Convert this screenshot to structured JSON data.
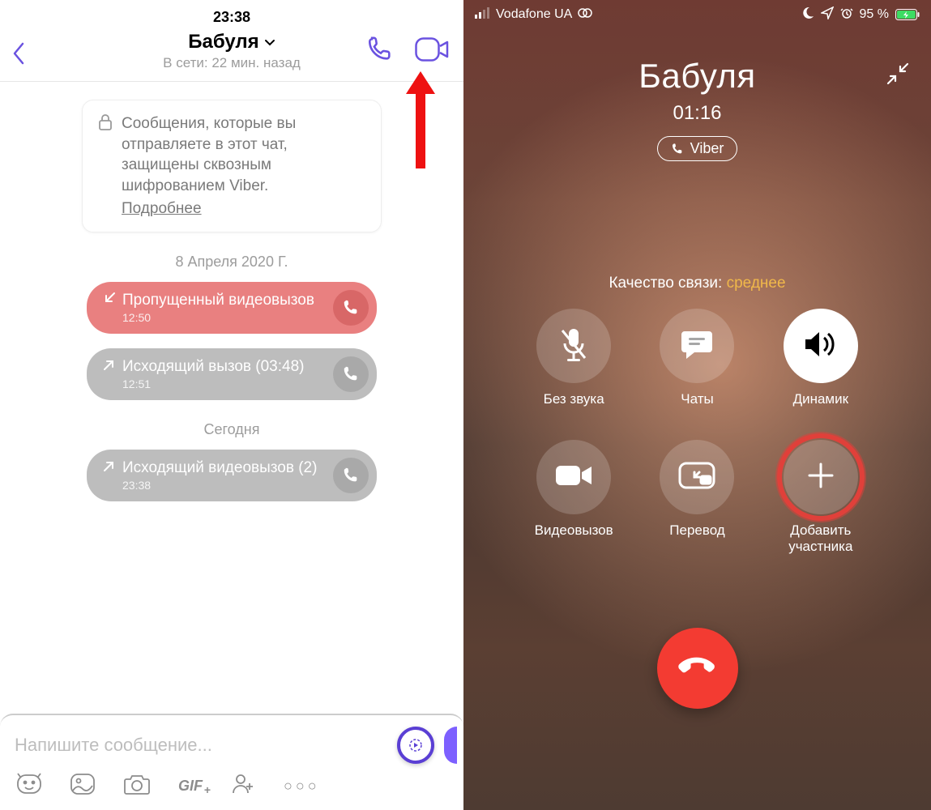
{
  "left": {
    "status_time": "23:38",
    "contact_name": "Бабуля",
    "last_seen": "В сети: 22 мин. назад",
    "encryption_text": "Сообщения, которые вы отправляете в этот чат, защищены сквозным шифрованием Viber.",
    "encryption_more": "Подробнее",
    "date1": "8 Апреля 2020 Г.",
    "items": [
      {
        "title": "Пропущенный видеовызов",
        "time": "12:50",
        "direction": "in",
        "color": "red"
      },
      {
        "title": "Исходящий вызов (03:48)",
        "time": "12:51",
        "direction": "out",
        "color": "gray"
      }
    ],
    "date2": "Сегодня",
    "items2": [
      {
        "title": "Исходящий видеовызов (2)",
        "time": "23:38",
        "direction": "out",
        "color": "gray"
      }
    ],
    "input_placeholder": "Напишите сообщение..."
  },
  "right": {
    "carrier": "Vodafone UA",
    "battery": "95 %",
    "contact_name": "Бабуля",
    "duration": "01:16",
    "app_badge": "Viber",
    "quality_label": "Качество связи: ",
    "quality_value": "среднее",
    "btns": {
      "mute": "Без звука",
      "chats": "Чаты",
      "speaker": "Динамик",
      "video": "Видеовызов",
      "transfer": "Перевод",
      "add": "Добавить участника"
    }
  }
}
